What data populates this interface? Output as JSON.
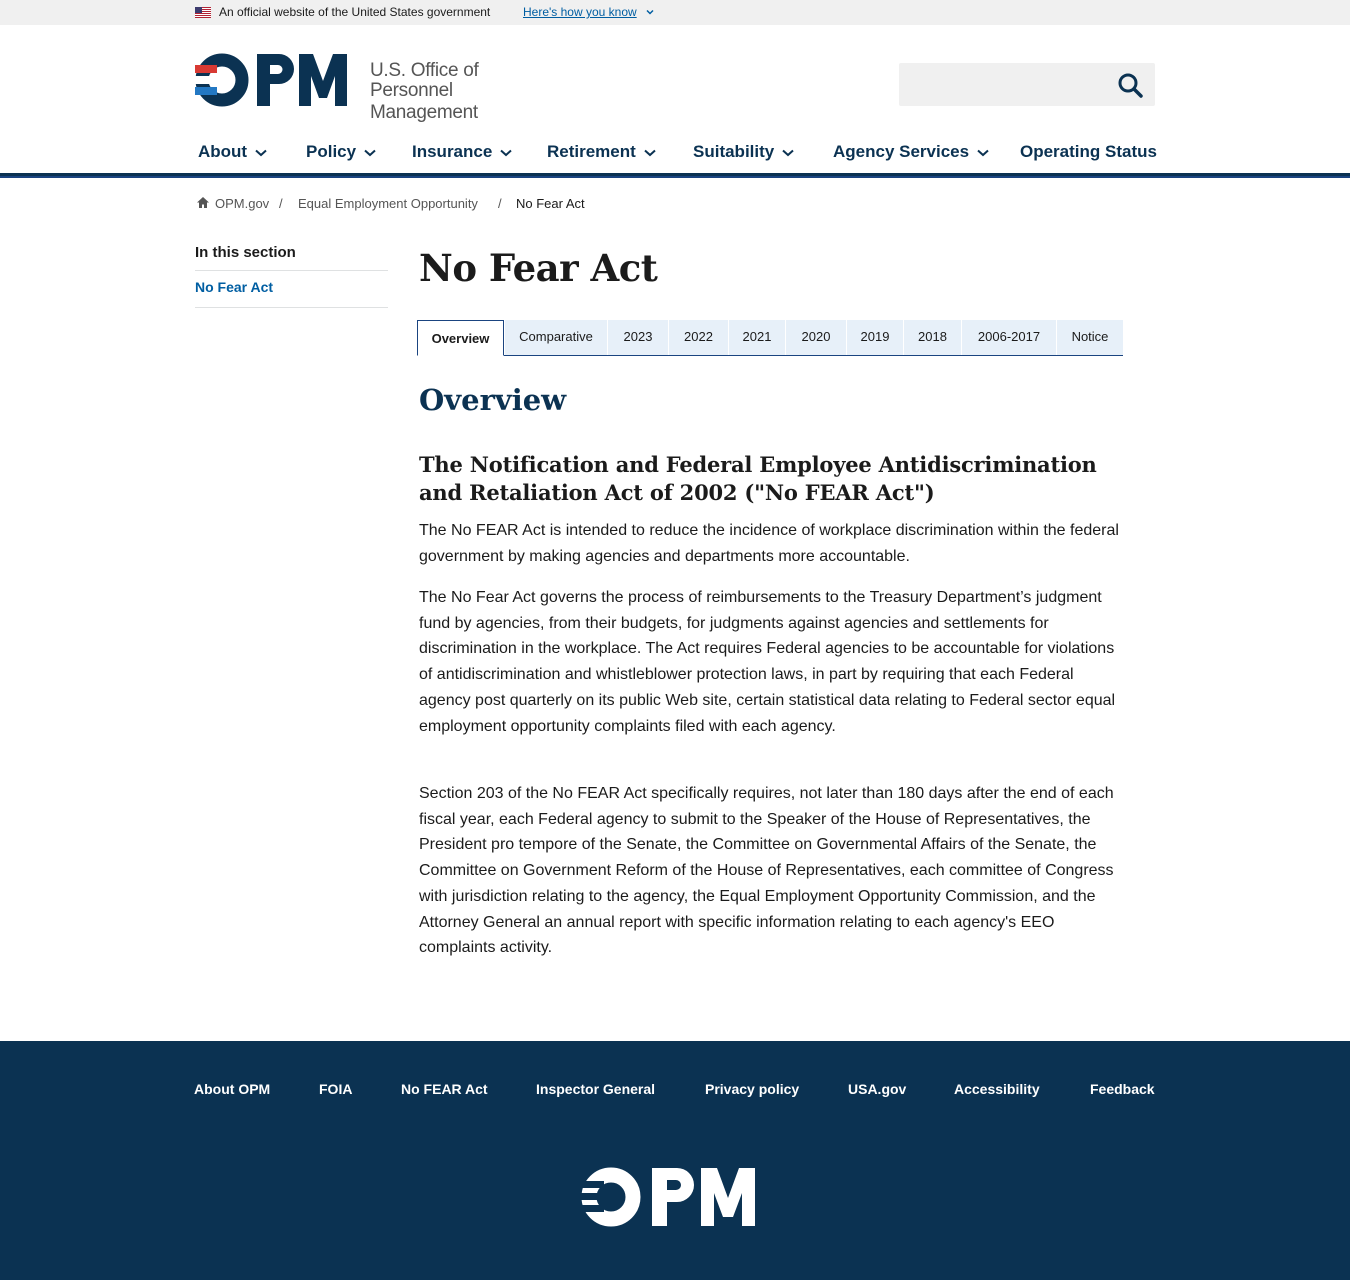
{
  "banner": {
    "official_text": "An official website of the United States government",
    "how_link": "Here's how you know"
  },
  "header": {
    "logo_text": "OPM",
    "org_line1": "U.S. Office of",
    "org_line2": "Personnel Management",
    "search_placeholder": "",
    "search_icon": "search-icon"
  },
  "nav": {
    "items": [
      {
        "label": "About",
        "has_dropdown": true
      },
      {
        "label": "Policy",
        "has_dropdown": true
      },
      {
        "label": "Insurance",
        "has_dropdown": true
      },
      {
        "label": "Retirement",
        "has_dropdown": true
      },
      {
        "label": "Suitability",
        "has_dropdown": true
      },
      {
        "label": "Agency Services",
        "has_dropdown": true
      },
      {
        "label": "Operating Status",
        "has_dropdown": false
      }
    ]
  },
  "breadcrumb": {
    "items": [
      "OPM.gov",
      "Equal Employment Opportunity",
      "No Fear Act"
    ],
    "separator": "/"
  },
  "sidebar": {
    "title": "In this section",
    "links": [
      "No Fear Act"
    ]
  },
  "main": {
    "title": "No Fear Act",
    "tabs": [
      "Overview",
      "Comparative",
      "2023",
      "2022",
      "2021",
      "2020",
      "2019",
      "2018",
      "2006-2017",
      "Notice"
    ],
    "active_tab": "Overview",
    "section_title": "Overview",
    "subtitle": "The Notification and Federal Employee Antidiscrimination and Retaliation Act of 2002 (\"No FEAR Act\")",
    "paragraphs": [
      "The No FEAR Act is intended to reduce the incidence of workplace discrimination within the federal government by making agencies and departments more accountable.",
      "The No Fear Act governs the process of reimbursements to the Treasury Department’s judgment fund by agencies, from their budgets, for judgments against agencies and settlements for discrimination in the workplace. The Act requires Federal agencies to be accountable for violations of antidiscrimination and whistleblower protection laws, in part by requiring that each Federal agency post quarterly on its public Web site, certain statistical data relating to Federal sector equal employment opportunity complaints filed with each agency.",
      "Section 203 of the No FEAR Act specifically requires, not later than 180 days after the end of each fiscal year, each Federal agency to submit to the Speaker of the House of Representatives, the President pro tempore of the Senate, the Committee on Governmental Affairs of the Senate, the Committee on Government Reform of the House of Representatives, each committee of Congress with jurisdiction relating to the agency, the Equal Employment Opportunity Commission, and the Attorney General an annual report with specific information relating to each agency's EEO complaints activity."
    ]
  },
  "footer": {
    "links": [
      "About OPM",
      "FOIA",
      "No FEAR Act",
      "Inspector General",
      "Privacy policy",
      "USA.gov",
      "Accessibility",
      "Feedback"
    ],
    "logo_text": "OPM"
  },
  "colors": {
    "navy": "#0b3252",
    "link_blue": "#005ea2",
    "tab_bg": "#e7f0f9",
    "logo_red": "#d83933",
    "logo_blue": "#2378c3"
  }
}
